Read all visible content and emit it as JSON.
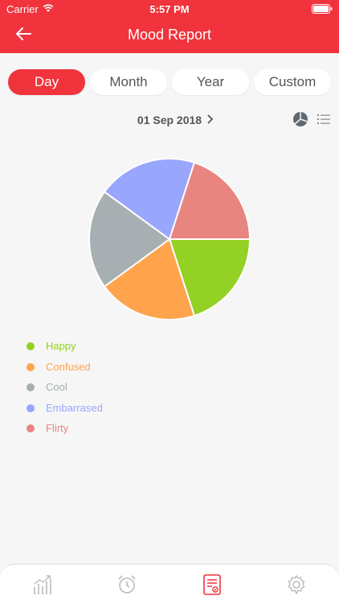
{
  "status": {
    "carrier": "Carrier",
    "time": "5:57 PM",
    "icons": [
      "wifi-icon",
      "battery-icon"
    ]
  },
  "header": {
    "title": "Mood Report",
    "back_icon": "arrow-left-icon",
    "color": "#f0333c"
  },
  "tabs": [
    {
      "label": "Day",
      "active": true
    },
    {
      "label": "Month",
      "active": false
    },
    {
      "label": "Year",
      "active": false
    },
    {
      "label": "Custom",
      "active": false
    }
  ],
  "date": {
    "label": "01 Sep 2018",
    "next_icon": "chevron-right-icon"
  },
  "view_toggle": {
    "icons": [
      "pie-chart-icon",
      "list-icon"
    ]
  },
  "chart_data": {
    "type": "pie",
    "categories": [
      "Happy",
      "Confused",
      "Cool",
      "Embarrased",
      "Flirty"
    ],
    "values": [
      20,
      20,
      20,
      20,
      20
    ],
    "colors": [
      "#93d124",
      "#ffa44d",
      "#a7afb2",
      "#98a6fc",
      "#e8857e"
    ],
    "legend_position": "bottom-left"
  },
  "bottom_nav": {
    "items": [
      {
        "icon": "stats-chart-icon",
        "active": false
      },
      {
        "icon": "alarm-clock-icon",
        "active": false
      },
      {
        "icon": "report-document-icon",
        "active": true
      },
      {
        "icon": "settings-gear-icon",
        "active": false
      }
    ],
    "active_color": "#f0333c",
    "inactive_color": "#bbbbbb"
  }
}
